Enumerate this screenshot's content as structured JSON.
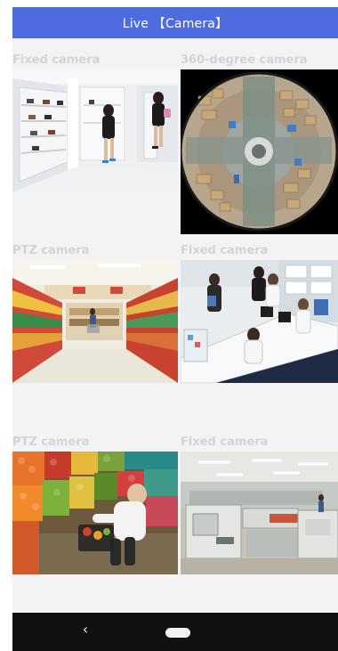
{
  "header": {
    "title": "Live 【Camera】",
    "color": "#4f6be0"
  },
  "cameras": [
    {
      "label": "Fixed camera",
      "scene": "shoe-store"
    },
    {
      "label": "360-degree camera",
      "scene": "warehouse-fisheye"
    },
    {
      "label": "PTZ camera",
      "scene": "supermarket-aisle"
    },
    {
      "label": "Fixed camera",
      "scene": "pharmacy-counter"
    },
    {
      "label": "PTZ camera",
      "scene": "produce-shopper"
    },
    {
      "label": "Fixed camera",
      "scene": "factory-floor"
    }
  ],
  "navbar": {
    "back_icon": "‹",
    "home_icon": "home-pill"
  }
}
